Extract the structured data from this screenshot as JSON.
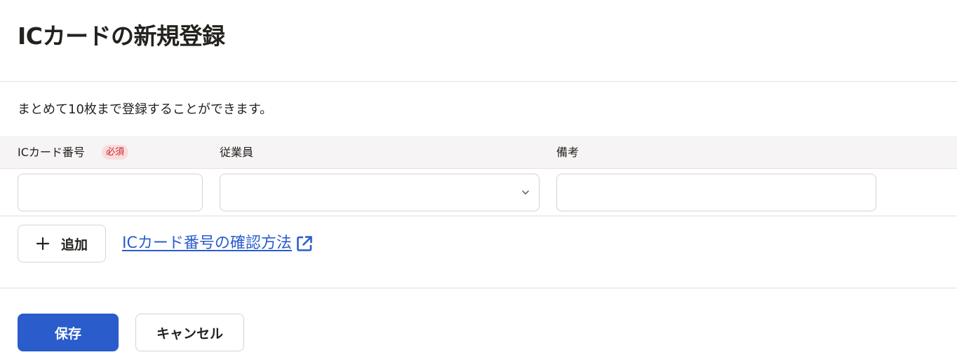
{
  "page": {
    "title": "ICカードの新規登録",
    "description": "まとめて10枚まで登録することができます。"
  },
  "table": {
    "columns": {
      "ic_number": "ICカード番号",
      "required_badge": "必須",
      "employee": "従業員",
      "notes": "備考"
    },
    "row": {
      "ic_number_value": "",
      "employee_value": "",
      "notes_value": ""
    }
  },
  "actions": {
    "add_label": "追加",
    "help_link": "ICカード番号の確認方法",
    "save_label": "保存",
    "cancel_label": "キャンセル"
  },
  "icons": {
    "add": "plus-icon",
    "select": "chevron-down-icon",
    "link": "external-link-icon"
  },
  "colors": {
    "primary": "#2a5ccc",
    "link": "#2a5ccc",
    "required_badge_bg": "#fbdcde",
    "required_badge_text": "#c1262a",
    "header_bg": "#f6f4f4",
    "border": "#d6d3d0"
  }
}
